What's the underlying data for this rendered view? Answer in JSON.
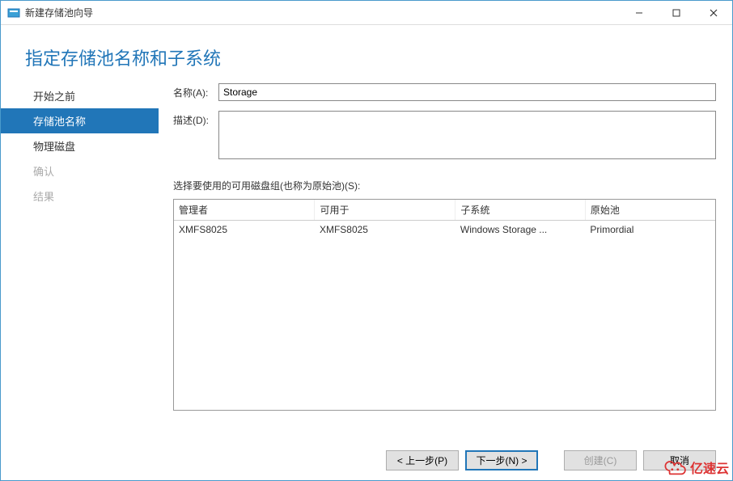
{
  "titlebar": {
    "title": "新建存储池向导"
  },
  "heading": "指定存储池名称和子系统",
  "sidebar": {
    "steps": [
      {
        "label": "开始之前",
        "state": "normal"
      },
      {
        "label": "存储池名称",
        "state": "active"
      },
      {
        "label": "物理磁盘",
        "state": "normal"
      },
      {
        "label": "确认",
        "state": "disabled"
      },
      {
        "label": "结果",
        "state": "disabled"
      }
    ]
  },
  "form": {
    "name_label": "名称(A):",
    "name_value": "Storage",
    "desc_label": "描述(D):",
    "desc_value": ""
  },
  "diskgroup": {
    "caption": "选择要使用的可用磁盘组(也称为原始池)(S):",
    "headers": {
      "manager": "管理者",
      "available": "可用于",
      "subsystem": "子系统",
      "pool": "原始池"
    },
    "rows": [
      {
        "manager": "XMFS8025",
        "available": "XMFS8025",
        "subsystem": "Windows Storage ...",
        "pool": "Primordial"
      }
    ]
  },
  "footer": {
    "prev": "< 上一步(P)",
    "next": "下一步(N) >",
    "create": "创建(C)",
    "cancel": "取消"
  },
  "watermark": {
    "text": "亿速云"
  }
}
